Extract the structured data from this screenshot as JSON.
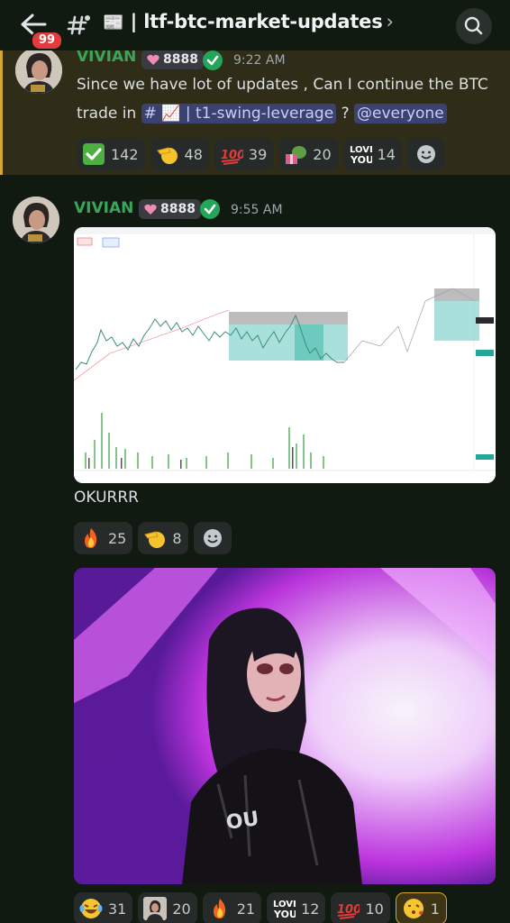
{
  "header": {
    "unread_count": "99",
    "channel_name": "ltf-btc-market-updates",
    "channel_emoji": "📰"
  },
  "messages": [
    {
      "author": "VIVIAN",
      "tag_count": "8888",
      "time": "9:22 AM",
      "text_before": "Since we have lot of updates , Can I continue the BTC trade in",
      "channel_mention": "# 📈 | t1-swing-leverage",
      "text_middle": "?",
      "everyone_mention": "@everyone",
      "reactions": [
        {
          "emoji": "✅",
          "count": "142"
        },
        {
          "emoji": "salute",
          "count": "48"
        },
        {
          "emoji": "💯",
          "count": "39"
        },
        {
          "emoji": "pepe-gift",
          "count": "20"
        },
        {
          "emoji": "LOVE YOU",
          "count": "14"
        }
      ]
    },
    {
      "author": "VIVIAN",
      "tag_count": "8888",
      "time": "9:55 AM",
      "text": "OKURRR",
      "reactions": [
        {
          "emoji": "🔥",
          "count": "25"
        },
        {
          "emoji": "salute",
          "count": "8"
        }
      ],
      "gif_reactions": [
        {
          "emoji": "😂",
          "count": "31"
        },
        {
          "emoji": "avatar-emoji",
          "count": "20"
        },
        {
          "emoji": "🔥",
          "count": "21"
        },
        {
          "emoji": "LOVE YOU",
          "count": "12"
        },
        {
          "emoji": "💯",
          "count": "10"
        },
        {
          "emoji": "😘",
          "count": "1"
        }
      ]
    }
  ],
  "colors": {
    "background": "#101a11",
    "highlight": "#2f2d18",
    "author": "#3ba55c",
    "mention": "#3c4270"
  }
}
